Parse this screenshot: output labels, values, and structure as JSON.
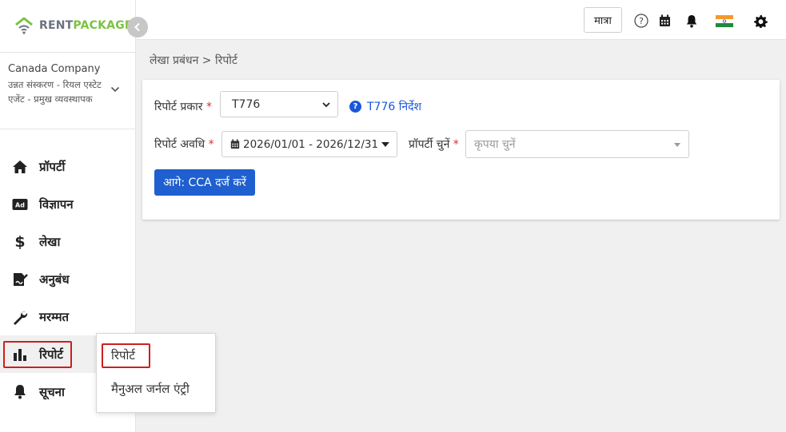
{
  "logo": {
    "part1": "RENT",
    "part2": "PACKAGE"
  },
  "company": {
    "name": "Canada Company",
    "role": "उन्नत संस्करण - रियल एस्टेट एजेंट - प्रमुख व्यवस्थापक"
  },
  "nav": [
    {
      "label": "प्रॉपर्टी",
      "icon": "home-icon"
    },
    {
      "label": "विज्ञापन",
      "icon": "ad-icon"
    },
    {
      "label": "लेखा",
      "icon": "dollar-icon"
    },
    {
      "label": "अनुबंध",
      "icon": "contract-icon"
    },
    {
      "label": "मरम्मत",
      "icon": "wrench-icon"
    },
    {
      "label": "रिपोर्ट",
      "icon": "bar-chart-icon",
      "active": true
    },
    {
      "label": "सूचना",
      "icon": "bell-icon"
    }
  ],
  "submenu": [
    {
      "label": "रिपोर्ट"
    },
    {
      "label": "मैनुअल जर्नल एंट्री"
    }
  ],
  "header": {
    "unit_button": "मात्रा"
  },
  "breadcrumb": "लेखा प्रबंधन > रिपोर्ट",
  "form": {
    "report_type_label": "रिपोर्ट प्रकार",
    "report_type_value": "T776",
    "help_link": "T776 निर्देश",
    "period_label": "रिपोर्ट अवधि",
    "period_value": "2026/01/01 - 2026/12/31",
    "property_label": "प्रॉपर्टी चुनें",
    "property_placeholder": "कृपया चुनें",
    "next_button": "आगे: CCA दर्ज करें",
    "required_mark": "*"
  },
  "colors": {
    "accent": "#1f5fcf",
    "brand_green": "#7cc242",
    "highlight": "#cc1f1f"
  }
}
